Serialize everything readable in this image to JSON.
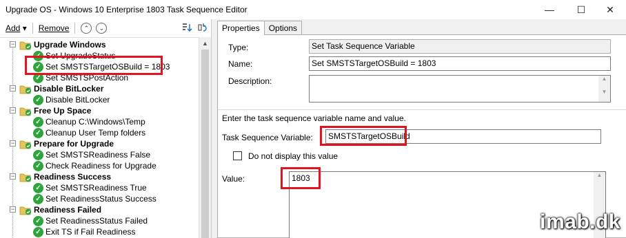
{
  "window": {
    "title": "Upgrade OS - Windows 10 Enterprise 1803 Task Sequence Editor",
    "minimize": "—",
    "maximize": "☐",
    "close": "✕"
  },
  "toolbar": {
    "add": "Add",
    "add_arrow": "▾",
    "remove": "Remove",
    "up": "⌃",
    "down": "⌄"
  },
  "tree": {
    "items": [
      {
        "label": "Upgrade Windows",
        "type": "group"
      },
      {
        "label": "Set UpgradeStatus",
        "type": "step"
      },
      {
        "label": "Set SMSTSTargetOSBuild = 1803",
        "type": "step"
      },
      {
        "label": "Set SMSTSPostAction",
        "type": "step"
      },
      {
        "label": "Disable BitLocker",
        "type": "group"
      },
      {
        "label": "Disable BitLocker",
        "type": "step"
      },
      {
        "label": "Free Up Space",
        "type": "group"
      },
      {
        "label": "Cleanup C:\\Windows\\Temp",
        "type": "step"
      },
      {
        "label": "Cleanup User Temp folders",
        "type": "step"
      },
      {
        "label": "Prepare for Upgrade",
        "type": "group"
      },
      {
        "label": "Set SMSTSReadiness False",
        "type": "step"
      },
      {
        "label": "Check Readiness for Upgrade",
        "type": "step"
      },
      {
        "label": "Readiness Success",
        "type": "group"
      },
      {
        "label": "Set SMSTSReadiness True",
        "type": "step"
      },
      {
        "label": "Set ReadinessStatus Success",
        "type": "step"
      },
      {
        "label": "Readiness Failed",
        "type": "group"
      },
      {
        "label": "Set ReadinessStatus Failed",
        "type": "step"
      },
      {
        "label": "Exit TS if Fail Readiness",
        "type": "step"
      }
    ]
  },
  "tabs": [
    {
      "label": "Properties"
    },
    {
      "label": "Options"
    }
  ],
  "properties": {
    "type_label": "Type:",
    "type_value": "Set Task Sequence Variable",
    "name_label": "Name:",
    "name_value": "Set SMSTSTargetOSBuild = 1803",
    "description_label": "Description:",
    "description_value": "",
    "instruction": "Enter the task sequence variable name and value.",
    "variable_label": "Task Sequence Variable:",
    "variable_value": "SMSTSTargetOSBuild",
    "hide_value_label": "Do not display this value",
    "hide_value_checked": false,
    "value_label": "Value:",
    "value_value": "1803"
  },
  "watermark": "imab.dk",
  "colors": {
    "highlight": "#e0141e",
    "check_green": "#2ea53a",
    "folder": "#e8c25a"
  }
}
